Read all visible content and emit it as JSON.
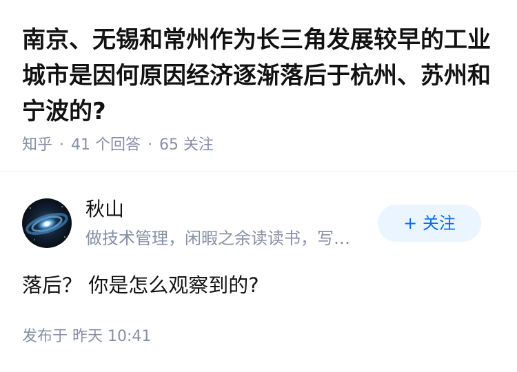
{
  "question": {
    "title": "南京、无锡和常州作为长三角发展较早的工业城市是因何原因经济逐渐落后于杭州、苏州和宁波的?",
    "source": "知乎",
    "separator": "·",
    "answer_count": "41 个回答",
    "follow_count": "65 关注"
  },
  "answer": {
    "author": {
      "name": "秋山",
      "bio": "做技术管理，闲暇之余读读书，写…",
      "avatar_icon": "galaxy-avatar-icon"
    },
    "follow_button_label": "+ 关注",
    "content": "落后？ 你是怎么观察到的?",
    "published": "发布于  昨天 10:41"
  },
  "colors": {
    "text_primary": "#121212",
    "text_secondary": "#8590a6",
    "accent": "#056de8",
    "follow_button_bg": "#ebf5ff",
    "divider": "#ebebeb"
  }
}
